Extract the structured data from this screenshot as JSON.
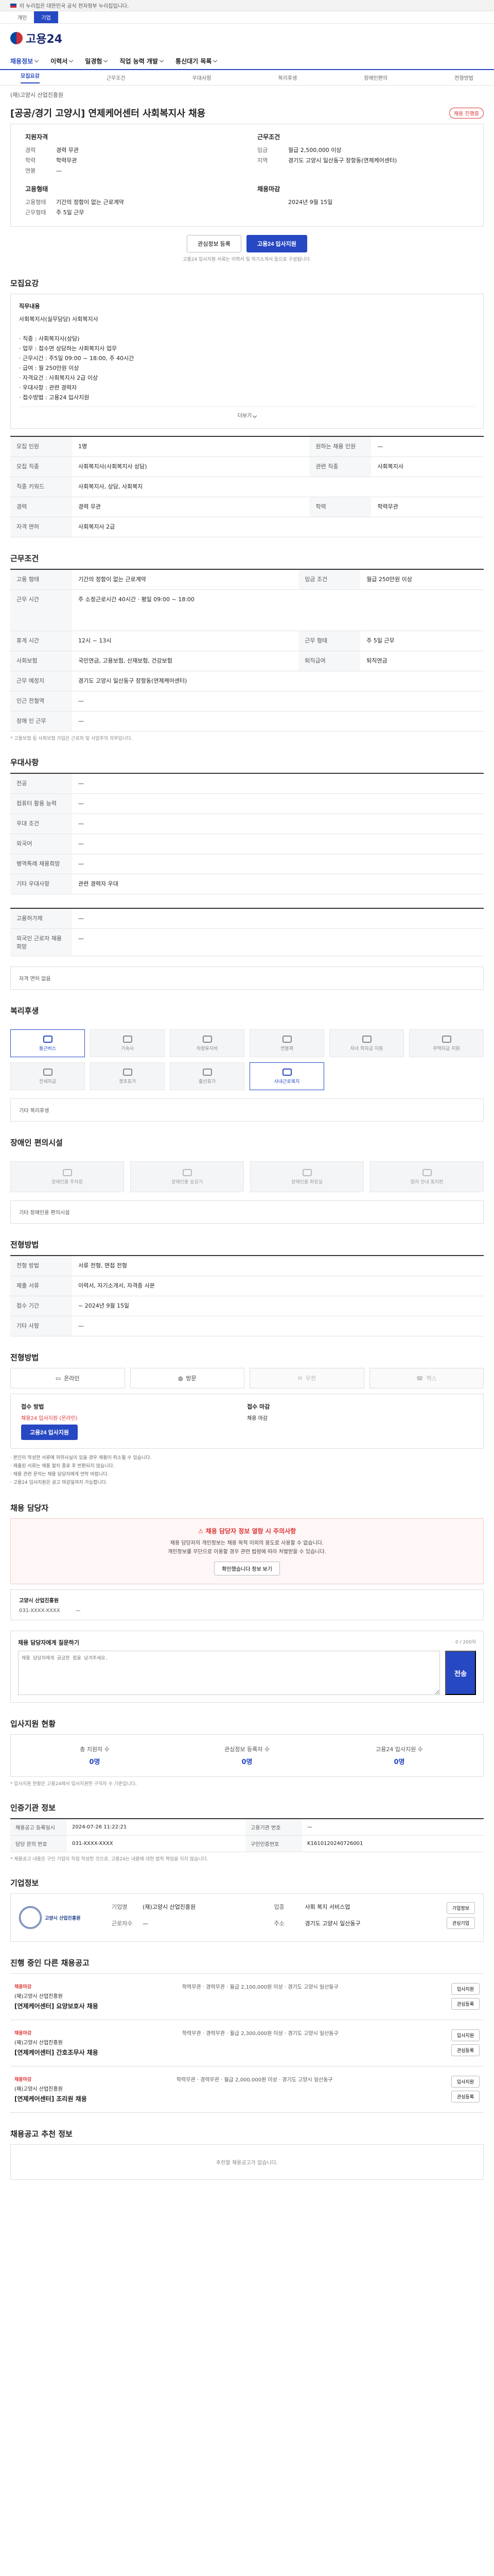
{
  "topbar": {
    "notice": "이 누리집은 대한민국 공식 전자정부 누리집입니다."
  },
  "gov_tabs": [
    "개인",
    "기업"
  ],
  "logo": "고용24",
  "gnb": [
    "채용정보",
    "이력서",
    "일경험",
    "직업 능력 개발",
    "통신대기 목록"
  ],
  "subtabs": [
    "모집요강",
    "근무조건",
    "우대사항",
    "복리후생",
    "장애인편의",
    "전형방법"
  ],
  "job": {
    "company": "(재)고양시 산업진흥원",
    "title": "[공공/경기 고양시] 연제케어센터 사회복지사 채용",
    "badge": "채용 진행중"
  },
  "summary": {
    "left_head": "지원자격",
    "left": [
      [
        "경력",
        "경력 무관"
      ],
      [
        "학력",
        "학력무관"
      ],
      [
        "연봉",
        "—"
      ]
    ],
    "right_head": "근무조건",
    "right": [
      [
        "임금",
        "월급 2,500,000 이상"
      ],
      [
        "지역",
        "경기도 고양시 일산동구 장항동(연제케어센터)"
      ]
    ],
    "left2_head": "고용형태",
    "left2": [
      [
        "고용형태",
        "기간의 정함이 없는 근로계약"
      ],
      [
        "근무형태",
        "주 5일 근무"
      ]
    ],
    "right2_head": "채용마감",
    "right2": [
      [
        "",
        "2024년 9월 15일"
      ]
    ]
  },
  "cta": {
    "save": "관심정보 등록",
    "apply": "고용24 입사지원"
  },
  "cta_note": "고용24 입사지원 서류는 이력서 및 자기소개서 등으로 구성됩니다.",
  "duty": {
    "section": "모집요강",
    "head": "직무내용",
    "lines": [
      "사회복지사(실무담당) 사회복지사",
      "",
      "· 직종 : 사회복지사(상담)",
      "· 업무 : 접수면 상담하는 사회복지사 업무",
      "· 근무시간 : 주5일 09:00 ~ 18:00, 주 40시간",
      "· 급여 : 월 250만원 이상",
      "· 자격요건 : 사회복지사 2급 이상",
      "· 우대사항 : 관련 경력자",
      "· 접수방법 : 고용24 입사지원"
    ],
    "more": "더보기"
  },
  "recruit_table": [
    [
      "모집 인원",
      "1명",
      "원하는 채용 인원",
      "—"
    ],
    [
      "모집 직종",
      "사회복지사(사회복지사 상담)",
      "관련 직종",
      "사회복지사"
    ],
    [
      "직종 키워드",
      "사회복지사, 상담, 사회복지",
      "",
      ""
    ],
    [
      "경력",
      "경력 무관",
      "학력",
      "학력무관"
    ],
    [
      "자격 면허",
      "사회복지사 2급",
      "",
      ""
    ]
  ],
  "work_table": [
    [
      "고용 형태",
      "기간의 정함이 없는 근로계약",
      "임금 조건",
      "월급 250만원 이상"
    ],
    [
      "근무 시간",
      "주 소정근로시간 40시간 · 평일 09:00 ~ 18:00",
      "",
      ""
    ],
    [
      "휴게 시간",
      "12시 ~ 13시",
      "근무 형태",
      "주 5일 근무"
    ],
    [
      "사회보험",
      "국민연금, 고용보험, 산재보험, 건강보험",
      "퇴직급여",
      "퇴직연금"
    ],
    [
      "근무 예정지",
      "경기도 고양시 일산동구 장항동(연제케어센터)",
      "",
      ""
    ],
    [
      "인근 전철역",
      "—",
      "",
      ""
    ],
    [
      "장애 인 근무",
      "—",
      "",
      ""
    ]
  ],
  "work_note": "* 고용보험 등 사회보험 가입은 근로자 및 사업주의 의무입니다.",
  "pref_table": [
    [
      "전공",
      "—"
    ],
    [
      "컴퓨터 활용 능력",
      "—"
    ],
    [
      "우대 조건",
      "—"
    ],
    [
      "외국어",
      "—"
    ],
    [
      "병역특례 채용희망",
      "—"
    ],
    [
      "기타 우대사항",
      "관련 경력자 우대"
    ]
  ],
  "etc_table": [
    [
      "고용허가제",
      "—"
    ],
    [
      "외국인 근로자 채용 희망",
      "—"
    ]
  ],
  "etc_more": "자격 면허 없음",
  "welfare": {
    "section": "복리후생",
    "items": [
      "통근버스",
      "기숙사",
      "차량유지비",
      "연봉제",
      "자녀 학자금 지원",
      "주택자금 지원",
      "전세자금",
      "경조휴가",
      "출산휴가",
      "사내근로복지"
    ],
    "on": [
      "통근버스",
      "사내근로복지"
    ],
    "more": "기타 복리후생"
  },
  "disabled": {
    "section": "장애인 편의시설",
    "items": [
      "장애인용 주차장",
      "장애인용 승강기",
      "장애인용 화장실",
      "점자 안내 표지판"
    ],
    "more": "기타 장애인용 편의시설"
  },
  "process_table": [
    [
      "전형 방법",
      "서류 전형, 면접 전형"
    ],
    [
      "제출 서류",
      "이력서, 자기소개서, 자격증 사본"
    ],
    [
      "접수 기간",
      "~ 2024년 9월 15일"
    ],
    [
      "기타 사항",
      "—"
    ]
  ],
  "apply_method": {
    "section": "전형방법",
    "methods": [
      "온라인",
      "방문",
      "우편",
      "팩스"
    ],
    "on": [
      0,
      1
    ],
    "left_head": "접수 방법",
    "left_value": "채용24 입사지원 (온라인)",
    "left_btn": "고용24 입사지원",
    "right_head": "접수 마감",
    "right_value": "채용 마감",
    "bullets": [
      "· 본인이 작성한 서류에 허위사실이 있을 경우 채용이 취소될 수 있습니다.",
      "· 제출된 서류는 채용 절차 종료 후 반환되지 않습니다.",
      "· 채용 관련 문의는 채용 담당자에게 연락 바랍니다.",
      "· 고용24 입사지원은 공고 마감일까지 가능합니다."
    ]
  },
  "manager": {
    "section": "채용 담당자",
    "notice_title": "채용 담당자 정보 열람 시 주의사항",
    "notice_lines": [
      "채용 담당자의 개인정보는 채용 목적 이외의 용도로 사용할 수 없습니다.",
      "개인정보를 무단으로 이용할 경우 관련 법령에 따라 처벌받을 수 있습니다."
    ],
    "notice_btn": "확인했습니다 정보 보기",
    "dept": "고양시 산업진흥원",
    "tel": "031-XXXX-XXXX",
    "fax": "—"
  },
  "question": {
    "title": "채용 담당자에게 질문하기",
    "counter": "0 / 200자",
    "placeholder": "채용 담당자에게 궁금한 점을 남겨주세요.",
    "send": "전송"
  },
  "stats": {
    "section": "입사지원 현황",
    "items": [
      [
        "총 지원자 수",
        "0명"
      ],
      [
        "관심정보 등록자 수",
        "0명"
      ],
      [
        "고용24 입사지원 수",
        "0명"
      ]
    ],
    "note": "* 입사지원 현황은 고용24에서 입사지원한 구직자 수 기준입니다."
  },
  "auth_table": {
    "section": "인증기관 정보",
    "rows": [
      [
        "채용공고 등록일시",
        "2024-07-26 11:22:21",
        "고용기관 번호",
        "—"
      ],
      [
        "담당 문의 번호",
        "031-XXXX-XXXX",
        "구인인증번호",
        "K1610120240726001"
      ]
    ],
    "note": "* 채용공고 내용은 구인 기업이 직접 작성한 것으로, 고용24는 내용에 대한 법적 책임을 지지 않습니다."
  },
  "corp": {
    "section": "기업정보",
    "logo_text": "고양시 산업진흥원",
    "rows": [
      [
        "기업명",
        "(재)고양시 산업진흥원"
      ],
      [
        "업종",
        "사회 복지 서비스업"
      ],
      [
        "근로자수",
        "—"
      ],
      [
        "주소",
        "경기도 고양시 일산동구"
      ]
    ],
    "btn1": "기업정보",
    "btn2": "관심기업"
  },
  "others": {
    "section": "진행 중인 다른 채용공고",
    "cards": [
      {
        "tag": "채용마감",
        "co": "(재)고양시 산업진흥원",
        "ti": "[연제케어센터] 요양보호사 채용",
        "meta": "학력무관 · 경력무관 · 월급 2,100,000원 이상 · 경기도 고양시 일산동구"
      },
      {
        "tag": "채용마감",
        "co": "(재)고양시 산업진흥원",
        "ti": "[연제케어센터] 간호조무사 채용",
        "meta": "학력무관 · 경력무관 · 월급 2,300,000원 이상 · 경기도 고양시 일산동구"
      },
      {
        "tag": "채용마감",
        "co": "(재)고양시 산업진흥원",
        "ti": "[연제케어센터] 조리원 채용",
        "meta": "학력무관 · 경력무관 · 월급 2,000,000원 이상 · 경기도 고양시 일산동구"
      }
    ],
    "btn_apply": "입사지원",
    "btn_save": "관심등록"
  },
  "recommend": {
    "section": "채용공고 추천 정보",
    "empty": "추천할 채용공고가 없습니다."
  }
}
